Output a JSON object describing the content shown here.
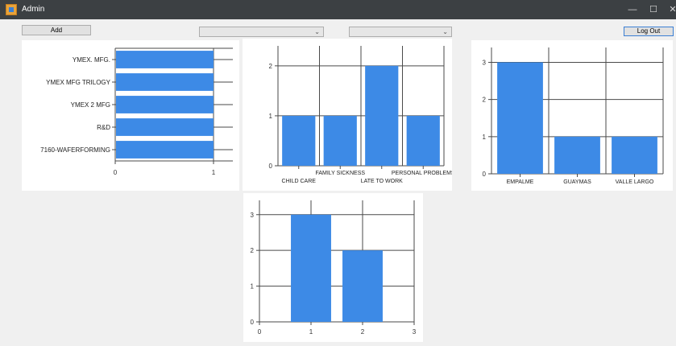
{
  "window": {
    "title": "Admin",
    "minimize_glyph": "—",
    "maximize_glyph": "☐",
    "close_glyph": "✕"
  },
  "toolbar": {
    "add_label": "Add",
    "logout_label": "Log Out",
    "combo1_value": "",
    "combo2_value": "",
    "dropdown_glyph": "⌄"
  },
  "colors": {
    "bar": "#3d8ae6",
    "grid": "#4a4a4a",
    "titlebar": "#3c4043"
  },
  "chart_data": [
    {
      "type": "bar",
      "orientation": "horizontal",
      "categories": [
        "YMEX. MFG.",
        "YMEX MFG TRILOGY",
        "YMEX  2 MFG",
        "R&D",
        "7160-WAFERFORMING"
      ],
      "values": [
        1,
        1,
        1,
        1,
        1
      ],
      "xlim": [
        0,
        1
      ],
      "xticks": [
        "0",
        "1"
      ],
      "grid": true
    },
    {
      "type": "bar",
      "categories": [
        "CHILD CARE",
        "FAMILY SICKNESS",
        "LATE TO WORK",
        "PERSONAL PROBLEMS"
      ],
      "values": [
        1,
        1,
        2,
        1
      ],
      "ylim": [
        0,
        2.4
      ],
      "yticks": [
        "0",
        "1",
        "2"
      ],
      "grid": true
    },
    {
      "type": "bar",
      "categories": [
        "EMPALME",
        "GUAYMAS",
        "VALLE LARGO"
      ],
      "values": [
        3,
        1,
        1
      ],
      "ylim": [
        0,
        3.4
      ],
      "yticks": [
        "0",
        "1",
        "2",
        "3"
      ],
      "grid": true
    },
    {
      "type": "bar",
      "x": [
        1,
        2
      ],
      "values": [
        3,
        2
      ],
      "xlim": [
        0,
        3
      ],
      "ylim": [
        0,
        3.4
      ],
      "xticks": [
        "0",
        "1",
        "2",
        "3"
      ],
      "yticks": [
        "0",
        "1",
        "2",
        "3"
      ],
      "grid": true
    }
  ]
}
